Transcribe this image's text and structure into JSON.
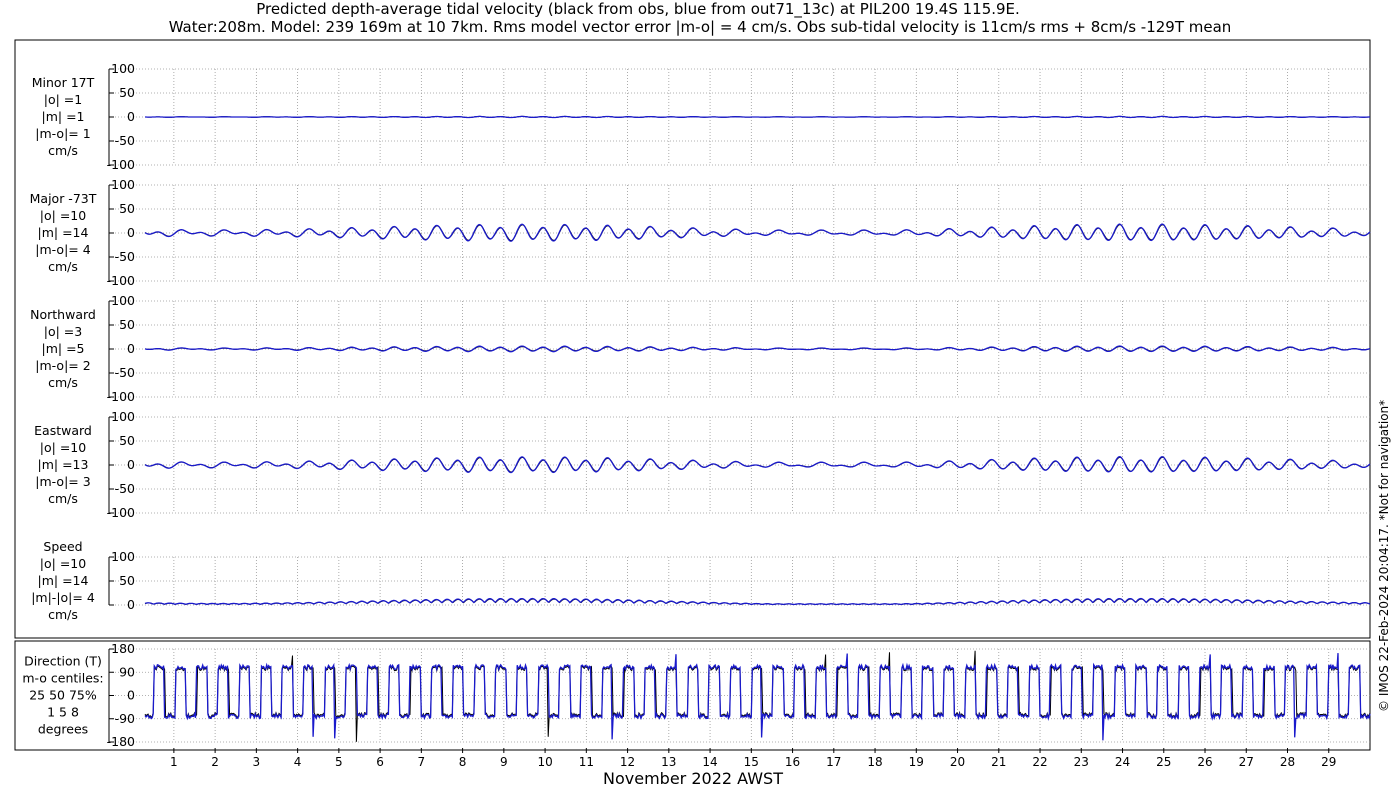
{
  "title_line1": "Predicted depth-average tidal velocity (black from obs, blue from out71_13c) at PIL200 19.4S 115.9E.",
  "title_line2": "Water:208m. Model: 239 169m at 10 7km. Rms model vector error |m-o| = 4 cm/s. Obs sub-tidal velocity is 11cm/s rms + 8cm/s -129T mean",
  "side_note": "© IMOS 22-Feb-2024 20:04:17. *Not for navigation*",
  "xlabel": "November 2022 AWST",
  "colors": {
    "obs": "#000000",
    "model": "#1a1acc"
  },
  "chart_data": [
    {
      "type": "line",
      "label_lines": [
        "Minor 17T",
        "|o| =1",
        "|m| =1",
        "|m-o|= 1",
        "cm/s"
      ],
      "ylim": [
        -100,
        100
      ],
      "yticks": [
        100,
        50,
        0,
        -50,
        -100
      ],
      "grid": true,
      "x_range_days": [
        0.3,
        30.0
      ],
      "xticks": [
        1,
        2,
        3,
        4,
        5,
        6,
        7,
        8,
        9,
        10,
        11,
        12,
        13,
        14,
        15,
        16,
        17,
        18,
        19,
        20,
        21,
        22,
        23,
        24,
        25,
        26,
        27,
        28,
        29
      ],
      "series": [
        {
          "name": "obs",
          "signal": "velocity",
          "amplitude": 1,
          "phase": 0
        },
        {
          "name": "model",
          "signal": "velocity",
          "amplitude": 1,
          "phase": 0.1
        }
      ]
    },
    {
      "type": "line",
      "label_lines": [
        "Major -73T",
        "|o| =10",
        "|m| =14",
        "|m-o|= 4",
        "cm/s"
      ],
      "ylim": [
        -100,
        100
      ],
      "yticks": [
        100,
        50,
        0,
        -50,
        -100
      ],
      "grid": true,
      "x_range_days": [
        0.3,
        30.0
      ],
      "xticks": [
        1,
        2,
        3,
        4,
        5,
        6,
        7,
        8,
        9,
        10,
        11,
        12,
        13,
        14,
        15,
        16,
        17,
        18,
        19,
        20,
        21,
        22,
        23,
        24,
        25,
        26,
        27,
        28,
        29
      ],
      "series": [
        {
          "name": "obs",
          "signal": "velocity",
          "amplitude": 14,
          "phase": 0
        },
        {
          "name": "model",
          "signal": "velocity",
          "amplitude": 15,
          "phase": 0.1
        }
      ]
    },
    {
      "type": "line",
      "label_lines": [
        "Northward",
        "|o| =3",
        "|m| =5",
        "|m-o|= 2",
        "cm/s"
      ],
      "ylim": [
        -100,
        100
      ],
      "yticks": [
        100,
        50,
        0,
        -50,
        -100
      ],
      "grid": true,
      "x_range_days": [
        0.3,
        30.0
      ],
      "xticks": [
        1,
        2,
        3,
        4,
        5,
        6,
        7,
        8,
        9,
        10,
        11,
        12,
        13,
        14,
        15,
        16,
        17,
        18,
        19,
        20,
        21,
        22,
        23,
        24,
        25,
        26,
        27,
        28,
        29
      ],
      "series": [
        {
          "name": "obs",
          "signal": "velocity",
          "amplitude": 4,
          "phase": 0
        },
        {
          "name": "model",
          "signal": "velocity",
          "amplitude": 5,
          "phase": 0.1
        }
      ]
    },
    {
      "type": "line",
      "label_lines": [
        "Eastward",
        "|o| =10",
        "|m| =13",
        "|m-o|= 3",
        "cm/s"
      ],
      "ylim": [
        -100,
        100
      ],
      "yticks": [
        100,
        50,
        0,
        -50,
        -100
      ],
      "grid": true,
      "x_range_days": [
        0.3,
        30.0
      ],
      "xticks": [
        1,
        2,
        3,
        4,
        5,
        6,
        7,
        8,
        9,
        10,
        11,
        12,
        13,
        14,
        15,
        16,
        17,
        18,
        19,
        20,
        21,
        22,
        23,
        24,
        25,
        26,
        27,
        28,
        29
      ],
      "series": [
        {
          "name": "obs",
          "signal": "velocity",
          "amplitude": 13,
          "phase": 0
        },
        {
          "name": "model",
          "signal": "velocity",
          "amplitude": 14,
          "phase": 0.1
        }
      ]
    },
    {
      "type": "line",
      "label_lines": [
        "Speed",
        "|o| =10",
        "|m| =14",
        "|m|-|o|= 4",
        "cm/s"
      ],
      "ylim": [
        0,
        100
      ],
      "yticks": [
        100,
        50,
        0
      ],
      "grid": true,
      "x_range_days": [
        0.3,
        30.0
      ],
      "xticks": [
        1,
        2,
        3,
        4,
        5,
        6,
        7,
        8,
        9,
        10,
        11,
        12,
        13,
        14,
        15,
        16,
        17,
        18,
        19,
        20,
        21,
        22,
        23,
        24,
        25,
        26,
        27,
        28,
        29
      ],
      "series": [
        {
          "name": "obs",
          "signal": "speed",
          "amplitude": 14,
          "phase": 0
        },
        {
          "name": "model",
          "signal": "speed",
          "amplitude": 15,
          "phase": 0.1
        }
      ]
    },
    {
      "type": "line",
      "label_lines": [
        "Direction (T)",
        "m-o centiles:",
        "25  50  75%",
        "1   5   8",
        "degrees"
      ],
      "ylim": [
        -180,
        180
      ],
      "yticks": [
        180,
        90,
        0,
        -90,
        -180
      ],
      "grid": true,
      "x_range_days": [
        0.3,
        30.0
      ],
      "xticks": [
        1,
        2,
        3,
        4,
        5,
        6,
        7,
        8,
        9,
        10,
        11,
        12,
        13,
        14,
        15,
        16,
        17,
        18,
        19,
        20,
        21,
        22,
        23,
        24,
        25,
        26,
        27,
        28,
        29
      ],
      "series": [
        {
          "name": "obs",
          "signal": "direction",
          "high": 105,
          "low": -75,
          "phase": 0
        },
        {
          "name": "model",
          "signal": "direction",
          "high": 110,
          "low": -80,
          "phase": 0.06
        }
      ]
    }
  ]
}
